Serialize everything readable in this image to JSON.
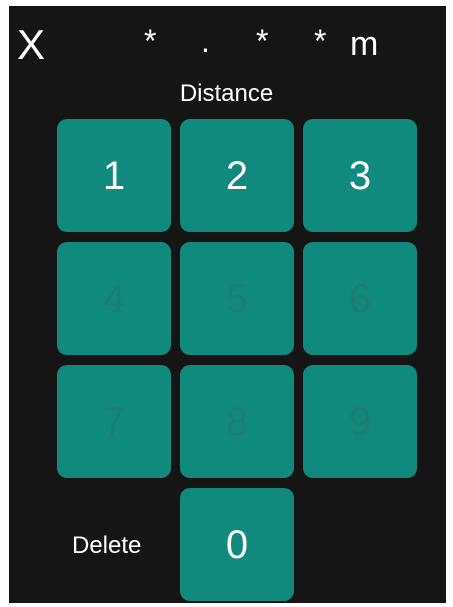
{
  "header": {
    "close_label": "X",
    "mask": [
      "*",
      ".",
      "*",
      "*"
    ],
    "unit": "m"
  },
  "label": "Distance",
  "keypad": {
    "keys": [
      "1",
      "2",
      "3",
      "4",
      "5",
      "6",
      "7",
      "8",
      "9",
      "0"
    ],
    "delete_label": "Delete"
  }
}
